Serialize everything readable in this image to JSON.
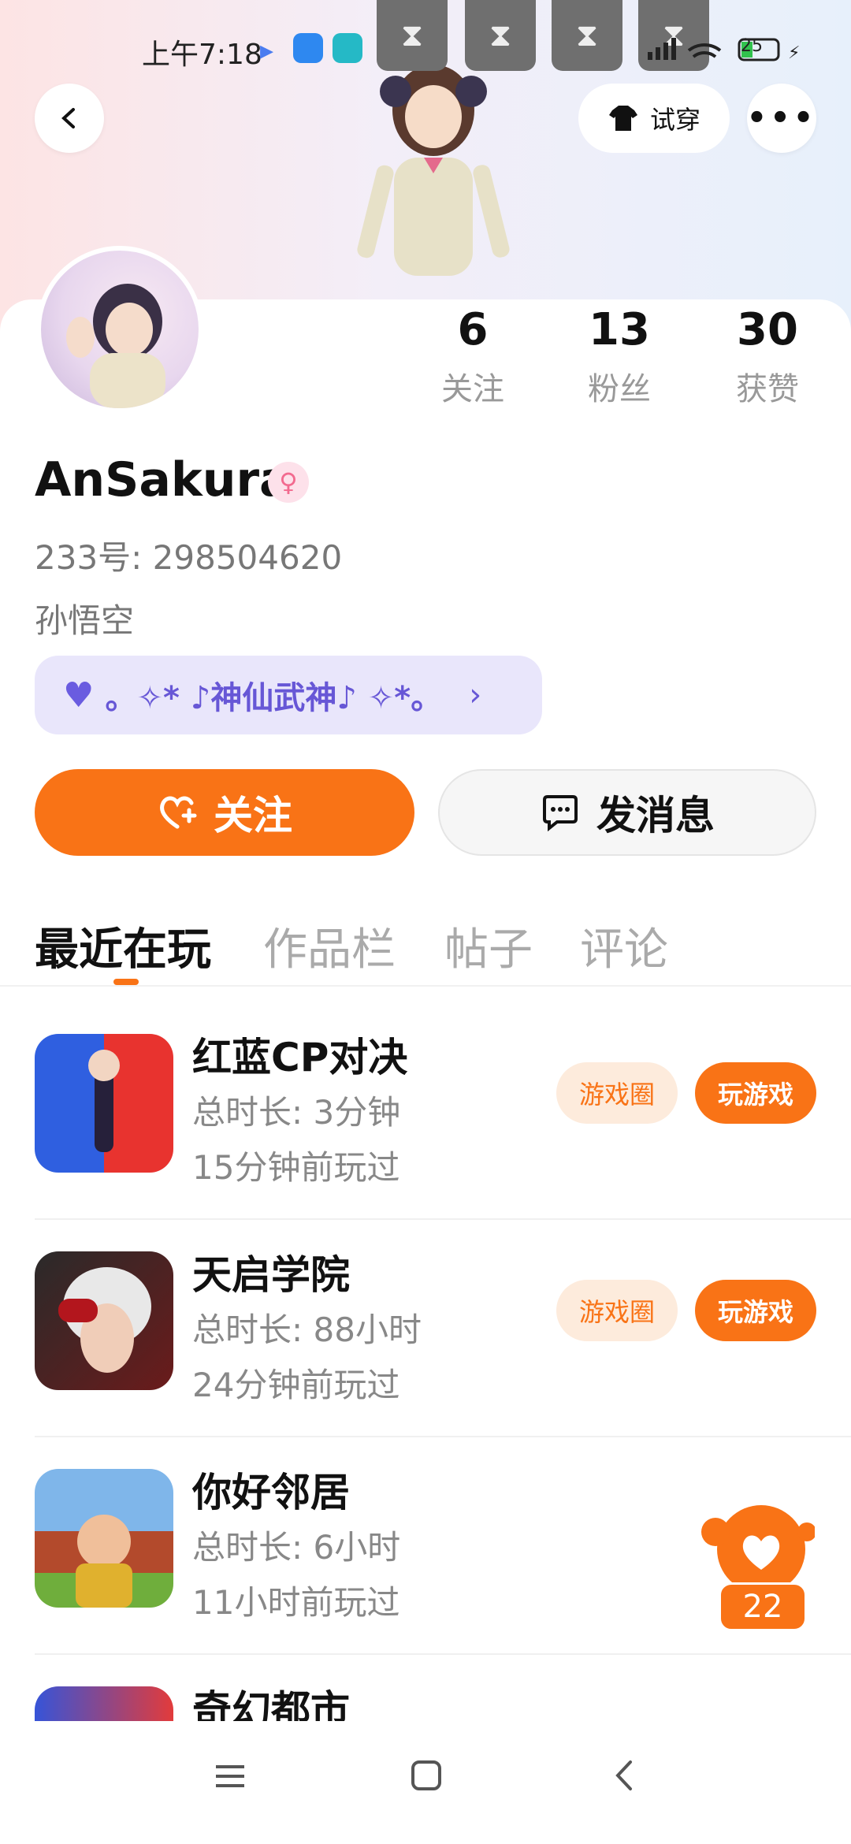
{
  "status_bar": {
    "time": "上午7:18",
    "battery": "25"
  },
  "header": {
    "tryon_label": "试穿"
  },
  "stats": [
    {
      "value": "6",
      "label": "关注"
    },
    {
      "value": "13",
      "label": "粉丝"
    },
    {
      "value": "30",
      "label": "获赞"
    }
  ],
  "profile": {
    "name": "AnSakura",
    "uid": "233号: 298504620",
    "signature": "孙悟空",
    "badge": "。✧* ♪神仙武神♪ ✧*。"
  },
  "actions": {
    "follow": "关注",
    "message": "发消息"
  },
  "tabs": [
    "最近在玩",
    "作品栏",
    "帖子",
    "评论"
  ],
  "games": [
    {
      "title": "红蓝CP对决",
      "duration": "总时长: 3分钟",
      "last": "15分钟前玩过",
      "circle": "游戏圈",
      "play": "玩游戏"
    },
    {
      "title": "天启学院",
      "duration": "总时长: 88小时",
      "last": "24分钟前玩过",
      "circle": "游戏圈",
      "play": "玩游戏"
    },
    {
      "title": "你好邻居",
      "duration": "总时长: 6小时",
      "last": "11小时前玩过"
    },
    {
      "title": "奇幻都市"
    }
  ],
  "like_count": "22"
}
